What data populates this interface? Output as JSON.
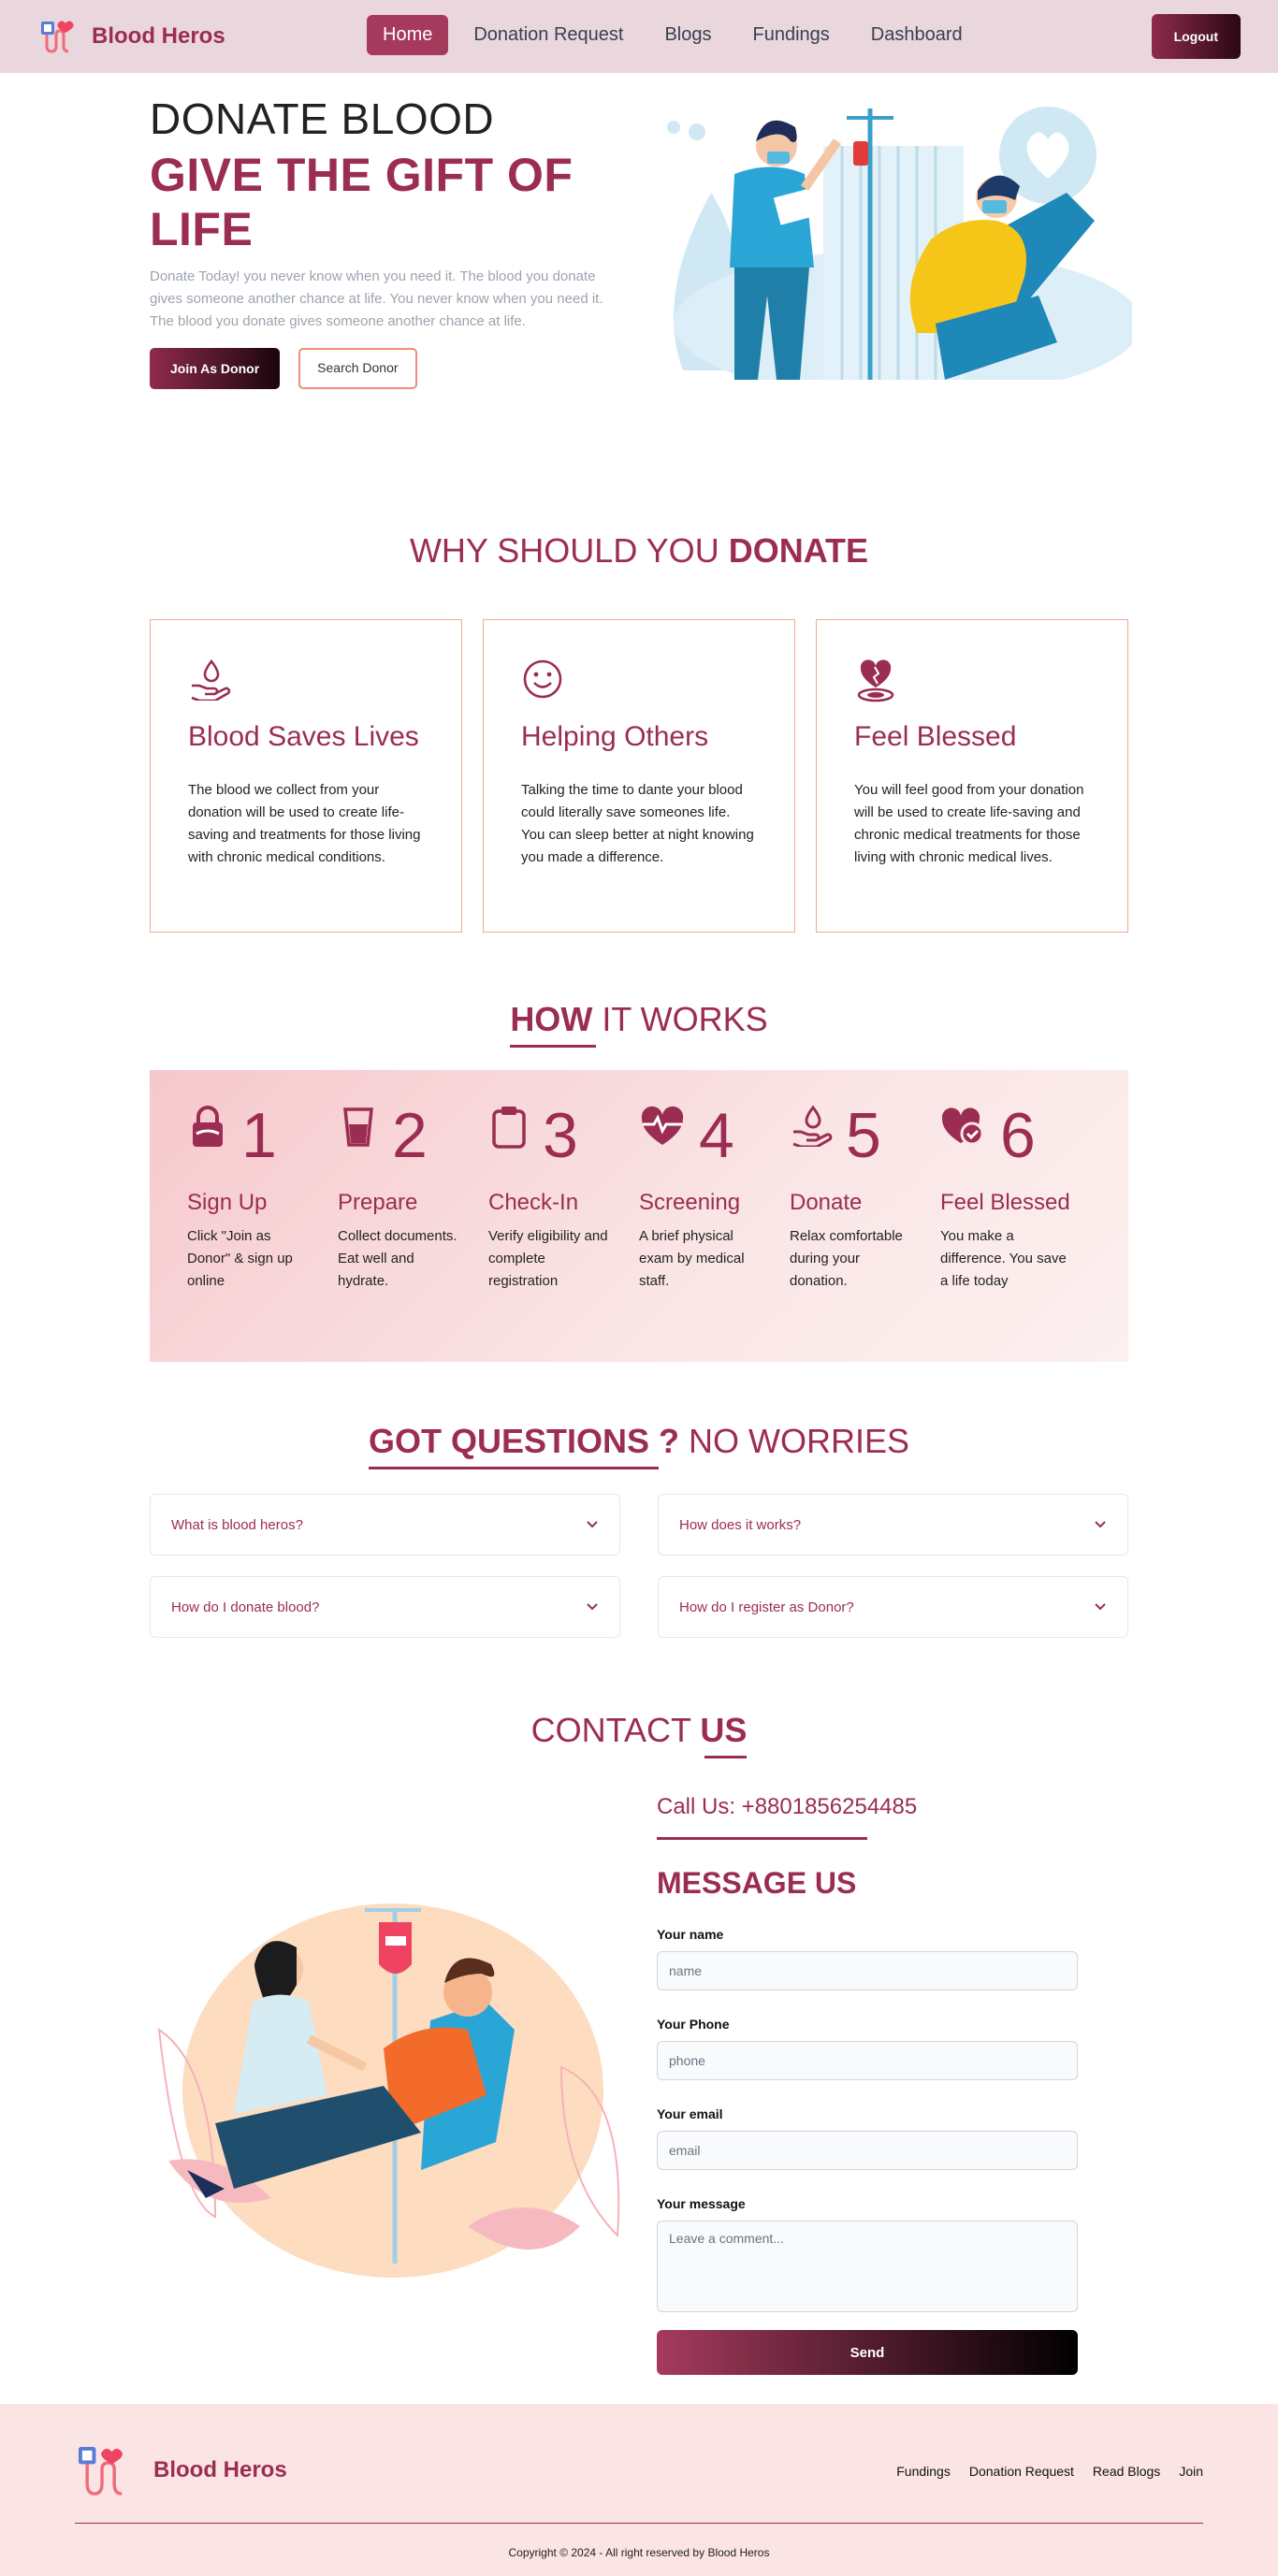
{
  "nav": {
    "brand": "Blood Heros",
    "links": [
      "Home",
      "Donation Request",
      "Blogs",
      "Fundings",
      "Dashboard"
    ],
    "logout": "Logout"
  },
  "hero": {
    "line1": "DONATE BLOOD",
    "line2": "GIVE THE GIFT OF LIFE",
    "paragraph": "Donate Today! you never know when you need it. The blood you donate gives someone another chance at life. You never know when you need it. The blood you donate gives someone another chance at life.",
    "join_btn": "Join As Donor",
    "search_btn": "Search Donor"
  },
  "why": {
    "title_light": "WHY SHOULD YOU",
    "title_bold": "DONATE",
    "cards": [
      {
        "icon": "hand-drop-icon",
        "title": "Blood Saves Lives",
        "text": "The blood we collect from your donation will be used to create life-saving and treatments for those living with chronic medical conditions."
      },
      {
        "icon": "smile-icon",
        "title": "Helping Others",
        "text": "Talking the time to dante your blood could literally save someones life. You can sleep better at night knowing you made a difference."
      },
      {
        "icon": "heart-hand-icon",
        "title": "Feel Blessed",
        "text": "You will feel good from your donation will be used to create life-saving and chronic medical treatments for those living with chronic medical lives."
      }
    ]
  },
  "how": {
    "title_bold": "HOW",
    "title_light": "IT WORKS",
    "steps": [
      {
        "num": "1",
        "icon": "lock-icon",
        "title": "Sign Up",
        "text": "Click \"Join as Donor\" & sign up online"
      },
      {
        "num": "2",
        "icon": "cup-icon",
        "title": "Prepare",
        "text": "Collect documents. Eat well and hydrate."
      },
      {
        "num": "3",
        "icon": "clipboard-icon",
        "title": "Check-In",
        "text": "Verify eligibility and complete registration"
      },
      {
        "num": "4",
        "icon": "heartbeat-icon",
        "title": "Screening",
        "text": "A brief physical exam by medical staff."
      },
      {
        "num": "5",
        "icon": "hand-drop-icon",
        "title": "Donate",
        "text": "Relax comfortable during your donation."
      },
      {
        "num": "6",
        "icon": "heart-check-icon",
        "title": "Feel Blessed",
        "text": "You make a difference. You save a life today"
      }
    ]
  },
  "faq": {
    "title_bold": "GOT QUESTIONS ?",
    "title_light": "NO WORRIES",
    "items": [
      "What is blood heros?",
      "How does it works?",
      "How do I donate blood?",
      "How do I register as Donor?"
    ]
  },
  "contact": {
    "title_light": "CONTACT",
    "title_bold": "US",
    "call": "Call Us: +8801856254485",
    "message_title": "MESSAGE US",
    "name_label": "Your name",
    "name_placeholder": "name",
    "phone_label": "Your Phone",
    "phone_placeholder": "phone",
    "email_label": "Your email",
    "email_placeholder": "email",
    "message_label": "Your message",
    "message_placeholder": "Leave a comment...",
    "send": "Send"
  },
  "footer": {
    "brand": "Blood Heros",
    "links": [
      "Fundings",
      "Donation Request",
      "Read Blogs",
      "Join"
    ],
    "copyright": "Copyright © 2024 - All right reserved by Blood Heros"
  },
  "colors": {
    "accent": "#9b2d52",
    "nav_bg": "#ead7dd",
    "footer_bg": "#fbe4e4",
    "card_border": "#f7a598"
  }
}
